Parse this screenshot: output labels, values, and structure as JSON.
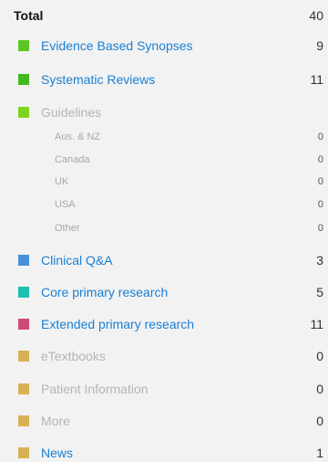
{
  "total": {
    "label": "Total",
    "count": "40"
  },
  "categories": [
    {
      "label": "Evidence Based Synopses",
      "count": "9",
      "color": "#5ec422",
      "state": "active"
    },
    {
      "label": "Systematic Reviews",
      "count": "11",
      "color": "#43b91f",
      "state": "active"
    },
    {
      "label": "Guidelines",
      "count": "",
      "color": "#7ed321",
      "state": "disabled"
    },
    {
      "label": "Clinical Q&A",
      "count": "3",
      "color": "#4a90d9",
      "state": "active"
    },
    {
      "label": "Core primary research",
      "count": "5",
      "color": "#1ebfb3",
      "state": "active"
    },
    {
      "label": "Extended primary research",
      "count": "11",
      "color": "#d04a78",
      "state": "active"
    },
    {
      "label": "eTextbooks",
      "count": "0",
      "color": "#d9b155",
      "state": "disabled"
    },
    {
      "label": "Patient Information",
      "count": "0",
      "color": "#d9b155",
      "state": "disabled"
    },
    {
      "label": "More",
      "count": "0",
      "color": "#d9b155",
      "state": "disabled"
    },
    {
      "label": "News",
      "count": "1",
      "color": "#d9b155",
      "state": "active"
    }
  ],
  "guideline_subitems": [
    {
      "label": "Aus. & NZ",
      "count": "0"
    },
    {
      "label": "Canada",
      "count": "0"
    },
    {
      "label": "UK",
      "count": "0"
    },
    {
      "label": "USA",
      "count": "0"
    },
    {
      "label": "Other",
      "count": "0"
    }
  ]
}
